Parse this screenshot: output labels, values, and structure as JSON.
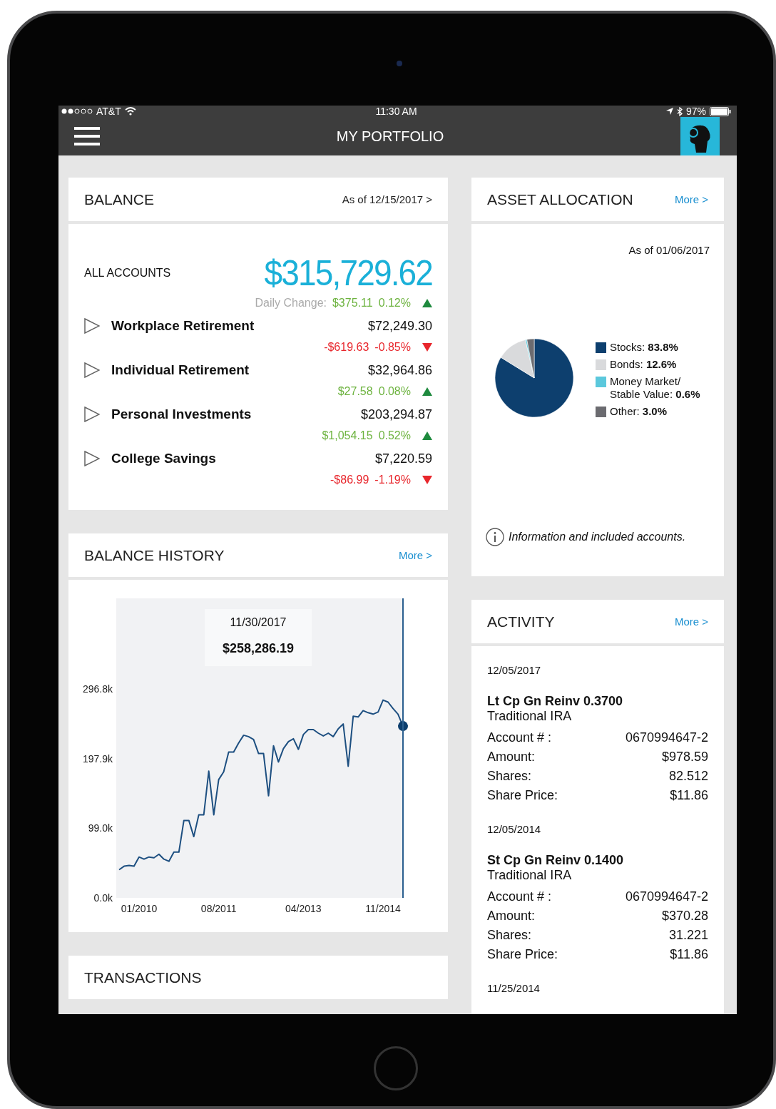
{
  "status_bar": {
    "carrier": "AT&T",
    "time": "11:30 AM",
    "battery": "97%"
  },
  "nav_bar": {
    "title": "MY PORTFOLIO"
  },
  "balance": {
    "title": "BALANCE",
    "as_of": "As of 12/15/2017 >",
    "total_label": "ALL ACCOUNTS",
    "total": "$315,729.62",
    "daily_label": "Daily Change:",
    "daily_amount": "$375.11",
    "daily_percent": "0.12%",
    "daily_up": true,
    "accounts": [
      {
        "name": "Workplace Retirement",
        "value": "$72,249.30",
        "change": "-$619.63",
        "percent": "-0.85%",
        "up": false
      },
      {
        "name": "Individual Retirement",
        "value": "$32,964.86",
        "change": "$27.58",
        "percent": "0.08%",
        "up": true
      },
      {
        "name": "Personal Investments",
        "value": "$203,294.87",
        "change": "$1,054.15",
        "percent": "0.52%",
        "up": true
      },
      {
        "name": "College Savings",
        "value": "$7,220.59",
        "change": "-$86.99",
        "percent": "-1.19%",
        "up": false
      }
    ]
  },
  "balance_history": {
    "title": "BALANCE HISTORY",
    "more": "More >",
    "tooltip": {
      "date": "11/30/2017",
      "value": "$258,286.19"
    },
    "chart_data": {
      "type": "line",
      "categories": [
        null,
        null,
        null,
        null,
        "01/2010",
        null,
        null,
        null,
        null,
        null,
        null,
        null,
        null,
        null,
        null,
        null,
        null,
        null,
        null,
        null,
        "08/2011",
        null,
        null,
        null,
        null,
        null,
        null,
        null,
        null,
        null,
        null,
        null,
        null,
        null,
        null,
        null,
        null,
        "04/2013",
        null,
        null,
        null,
        null,
        null,
        null,
        null,
        null,
        null,
        null,
        null,
        null,
        null,
        null,
        null,
        "11/2014",
        null,
        null,
        null,
        null
      ],
      "values": [
        40,
        45,
        46,
        45,
        58,
        55,
        58,
        57,
        62,
        55,
        52,
        65,
        65,
        110,
        110,
        87,
        118,
        118,
        180,
        118,
        168,
        179,
        207,
        207,
        220,
        231,
        229,
        225,
        205,
        205,
        145,
        216,
        193,
        212,
        222,
        226,
        211,
        232,
        239,
        239,
        234,
        230,
        234,
        229,
        240,
        247,
        187,
        258,
        257,
        266,
        263,
        261,
        264,
        281,
        278,
        269,
        261,
        244
      ],
      "ylim": [
        0,
        425.4
      ],
      "yticks": [
        {
          "value": 0,
          "label": "0.0k"
        },
        {
          "value": 99,
          "label": "99.0k"
        },
        {
          "value": 197.9,
          "label": "197.9k"
        },
        {
          "value": 296.8,
          "label": "296.8k"
        }
      ]
    }
  },
  "transactions": {
    "title": "TRANSACTIONS"
  },
  "asset_allocation": {
    "title": "ASSET ALLOCATION",
    "more": "More >",
    "as_of": "As of 01/06/2017",
    "chart_data": {
      "type": "pie",
      "categories": [
        "Stocks",
        "Bonds",
        "Money Market/ Stable Value",
        "Other"
      ],
      "values": [
        83.8,
        12.6,
        0.6,
        3.0
      ],
      "value_labels": [
        "83.8%",
        "12.6%",
        "0.6%",
        "3.0%"
      ]
    },
    "legend": [
      {
        "color": "#0d3f6e",
        "separator": ":"
      },
      {
        "color": "#d9dadc",
        "separator": ":"
      },
      {
        "color": "#5bc8dc",
        "separator": ":"
      },
      {
        "color": "#6b6b70",
        "separator": ":"
      }
    ],
    "info": "Information and included accounts."
  },
  "activity": {
    "title": "ACTIVITY",
    "more": "More >",
    "groups": [
      {
        "date": "12/05/2017",
        "items": [
          {
            "title": "Lt Cp Gn Reinv 0.3700",
            "account_type": "Traditional IRA",
            "rows": [
              {
                "label": "Account # :",
                "value": "0670994647-2"
              },
              {
                "label": "Amount:",
                "value": "$978.59"
              },
              {
                "label": "Shares:",
                "value": "82.512"
              },
              {
                "label": "Share Price:",
                "value": "$11.86"
              }
            ]
          }
        ]
      },
      {
        "date": "12/05/2014",
        "items": [
          {
            "title": "St Cp Gn Reinv 0.1400",
            "account_type": "Traditional IRA",
            "rows": [
              {
                "label": "Account # :",
                "value": "0670994647-2"
              },
              {
                "label": "Amount:",
                "value": "$370.28"
              },
              {
                "label": "Shares:",
                "value": "31.221"
              },
              {
                "label": "Share Price:",
                "value": "$11.86"
              }
            ]
          }
        ]
      },
      {
        "date": "11/25/2014"
      }
    ]
  }
}
